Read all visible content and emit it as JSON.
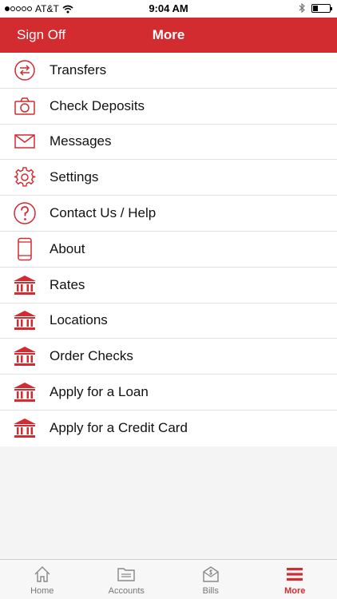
{
  "status_bar": {
    "carrier": "AT&T",
    "time": "9:04 AM",
    "signal_bars_filled": 1,
    "signal_bars_total": 5,
    "battery_level": 0.3
  },
  "navbar": {
    "sign_off_label": "Sign Off",
    "title": "More"
  },
  "menu": {
    "items": [
      {
        "label": "Transfers",
        "icon": "transfer-arrows-icon"
      },
      {
        "label": "Check Deposits",
        "icon": "camera-icon"
      },
      {
        "label": "Messages",
        "icon": "envelope-icon"
      },
      {
        "label": "Settings",
        "icon": "gear-icon"
      },
      {
        "label": "Contact Us / Help",
        "icon": "question-circle-icon"
      },
      {
        "label": "About",
        "icon": "phone-icon"
      },
      {
        "label": "Rates",
        "icon": "bank-icon"
      },
      {
        "label": "Locations",
        "icon": "bank-icon"
      },
      {
        "label": "Order Checks",
        "icon": "bank-icon"
      },
      {
        "label": "Apply for a Loan",
        "icon": "bank-icon"
      },
      {
        "label": "Apply for a Credit Card",
        "icon": "bank-icon"
      }
    ]
  },
  "tabbar": {
    "tabs": [
      {
        "label": "Home",
        "icon": "home-icon",
        "active": false
      },
      {
        "label": "Accounts",
        "icon": "accounts-icon",
        "active": false
      },
      {
        "label": "Bills",
        "icon": "bills-icon",
        "active": false
      },
      {
        "label": "More",
        "icon": "menu-icon",
        "active": true
      }
    ]
  },
  "colors": {
    "accent": "#d22b30",
    "tab_inactive": "#777777"
  }
}
